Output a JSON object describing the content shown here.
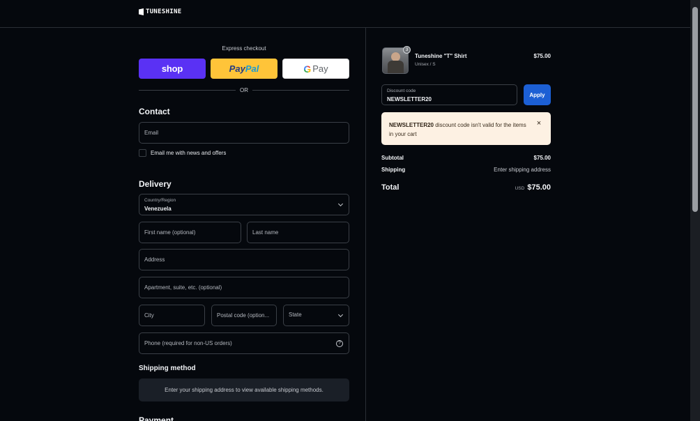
{
  "header": {
    "brand": "TUNESHINE"
  },
  "express": {
    "label": "Express checkout",
    "shop_label": "shop",
    "paypal_part1": "Pay",
    "paypal_part2": "Pal",
    "gpay_g": "G",
    "gpay_label": "Pay",
    "or_label": "OR"
  },
  "contact": {
    "title": "Contact",
    "email_placeholder": "Email",
    "newsletter_label": "Email me with news and offers"
  },
  "delivery": {
    "title": "Delivery",
    "country_label": "Country/Region",
    "country_value": "Venezuela",
    "first_name_placeholder": "First name (optional)",
    "last_name_placeholder": "Last name",
    "address_placeholder": "Address",
    "apartment_placeholder": "Apartment, suite, etc. (optional)",
    "city_placeholder": "City",
    "postal_placeholder": "Postal code (option...",
    "state_label": "State",
    "phone_placeholder": "Phone (required for non-US orders)",
    "help_icon": "?"
  },
  "shipping": {
    "title": "Shipping method",
    "message": "Enter your shipping address to view available shipping methods."
  },
  "payment": {
    "title": "Payment"
  },
  "cart": {
    "item": {
      "name": "Tuneshine \"T\" Shirt",
      "variant": "Unisex / S",
      "price": "$75.00",
      "quantity": "3"
    },
    "discount_label": "Discount code",
    "discount_value": "NEWSLETTER20",
    "apply_label": "Apply",
    "alert_code": "NEWSLETTER20",
    "alert_message": " discount code isn't valid for the items in your cart",
    "alert_close": "×",
    "subtotal_label": "Subtotal",
    "subtotal_value": "$75.00",
    "shipping_label": "Shipping",
    "shipping_value": "Enter shipping address",
    "total_label": "Total",
    "total_currency": "USD",
    "total_value": "$75.00"
  },
  "colors": {
    "background": "#05080d",
    "shop": "#5a31f4",
    "paypal": "#ffc439",
    "apply": "#1c5fd4",
    "alert_bg": "#fdf1e3"
  }
}
